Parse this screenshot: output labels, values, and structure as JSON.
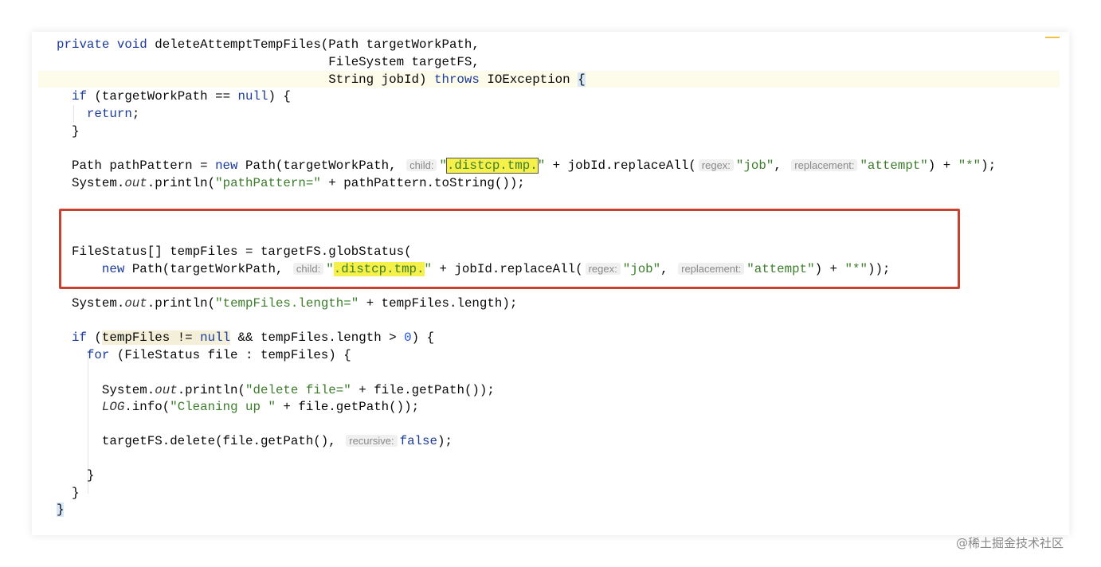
{
  "code_lines": [
    [
      [
        "private void ",
        "kw2"
      ],
      [
        "deleteAttemptTempFiles(Path targetWorkPath,",
        ""
      ]
    ],
    [
      [
        "                                    FileSystem targetFS,",
        ""
      ]
    ],
    [
      [
        "                                    String jobId) ",
        ""
      ],
      [
        "throws",
        "kw"
      ],
      [
        " IOException ",
        ""
      ],
      [
        "{",
        "brace"
      ]
    ],
    [
      [
        "  ",
        ""
      ],
      [
        "if",
        "kw"
      ],
      [
        " (targetWorkPath == ",
        ""
      ],
      [
        "null",
        "kw"
      ],
      [
        ") {",
        ""
      ]
    ],
    [
      [
        "    ",
        ""
      ],
      [
        "return",
        "kw"
      ],
      [
        ";",
        ""
      ]
    ],
    [
      [
        "  }",
        ""
      ]
    ],
    [],
    [
      [
        "  Path pathPattern = ",
        ""
      ],
      [
        "new",
        "kw"
      ],
      [
        " Path(targetWorkPath, ",
        ""
      ],
      [
        "child:",
        "hint"
      ],
      [
        "\"",
        "str"
      ],
      [
        ".distcp.tmp.",
        "str hl"
      ],
      [
        "\"",
        "str"
      ],
      [
        " + jobId.replaceAll(",
        ""
      ],
      [
        "regex:",
        "hint"
      ],
      [
        "\"job\"",
        "str"
      ],
      [
        ", ",
        ""
      ],
      [
        "replacement:",
        "hint"
      ],
      [
        "\"attempt\"",
        "str"
      ],
      [
        ") + ",
        ""
      ],
      [
        "\"*\"",
        "str"
      ],
      [
        ");",
        ""
      ]
    ],
    [
      [
        "  System.",
        ""
      ],
      [
        "out",
        "fld"
      ],
      [
        ".println(",
        ""
      ],
      [
        "\"pathPattern=\"",
        "str"
      ],
      [
        " + pathPattern.toString());",
        ""
      ]
    ],
    [],
    [],
    [
      [
        "  FileStatus[] tempFiles = targetFS.globStatus(",
        ""
      ]
    ],
    [
      [
        "      ",
        ""
      ],
      [
        "new",
        "kw"
      ],
      [
        " Path(targetWorkPath, ",
        ""
      ],
      [
        "child:",
        "hint"
      ],
      [
        "\"",
        "str"
      ],
      [
        ".distcp.tmp.",
        "str hl2"
      ],
      [
        "\"",
        "str"
      ],
      [
        " + jobId.replaceAll(",
        ""
      ],
      [
        "regex:",
        "hint"
      ],
      [
        "\"job\"",
        "str"
      ],
      [
        ", ",
        ""
      ],
      [
        "replacement:",
        "hint"
      ],
      [
        "\"attempt\"",
        "str"
      ],
      [
        ") + ",
        ""
      ],
      [
        "\"*\"",
        "str"
      ],
      [
        "));",
        ""
      ]
    ],
    [],
    [
      [
        "  System.",
        ""
      ],
      [
        "out",
        "fld"
      ],
      [
        ".println(",
        ""
      ],
      [
        "\"tempFiles.length=\"",
        "str"
      ],
      [
        " + tempFiles.length);",
        ""
      ]
    ],
    [],
    [
      [
        "  ",
        ""
      ],
      [
        "if",
        "kw"
      ],
      [
        " (",
        ""
      ],
      [
        "tempFiles != ",
        "usage"
      ],
      [
        "null",
        "kw usage"
      ],
      [
        " && tempFiles.length > ",
        ""
      ],
      [
        "0",
        "num"
      ],
      [
        ") {",
        ""
      ]
    ],
    [
      [
        "    ",
        ""
      ],
      [
        "for",
        "kw"
      ],
      [
        " (FileStatus file : tempFiles) {",
        ""
      ]
    ],
    [],
    [
      [
        "      System.",
        ""
      ],
      [
        "out",
        "fld"
      ],
      [
        ".println(",
        ""
      ],
      [
        "\"delete file=\"",
        "str"
      ],
      [
        " + file.getPath());",
        ""
      ]
    ],
    [
      [
        "      ",
        ""
      ],
      [
        "LOG",
        "fld kw"
      ],
      [
        ".info(",
        ""
      ],
      [
        "\"Cleaning up \"",
        "str"
      ],
      [
        " + file.getPath());",
        ""
      ]
    ],
    [],
    [
      [
        "      targetFS.delete(file.getPath(), ",
        ""
      ],
      [
        "recursive:",
        "hint"
      ],
      [
        "false",
        "kw"
      ],
      [
        ");",
        ""
      ]
    ],
    [],
    [
      [
        "    }",
        ""
      ]
    ],
    [
      [
        "  }",
        ""
      ]
    ],
    [
      [
        "}",
        "brace"
      ]
    ]
  ],
  "watermark": "@稀土掘金技术社区"
}
